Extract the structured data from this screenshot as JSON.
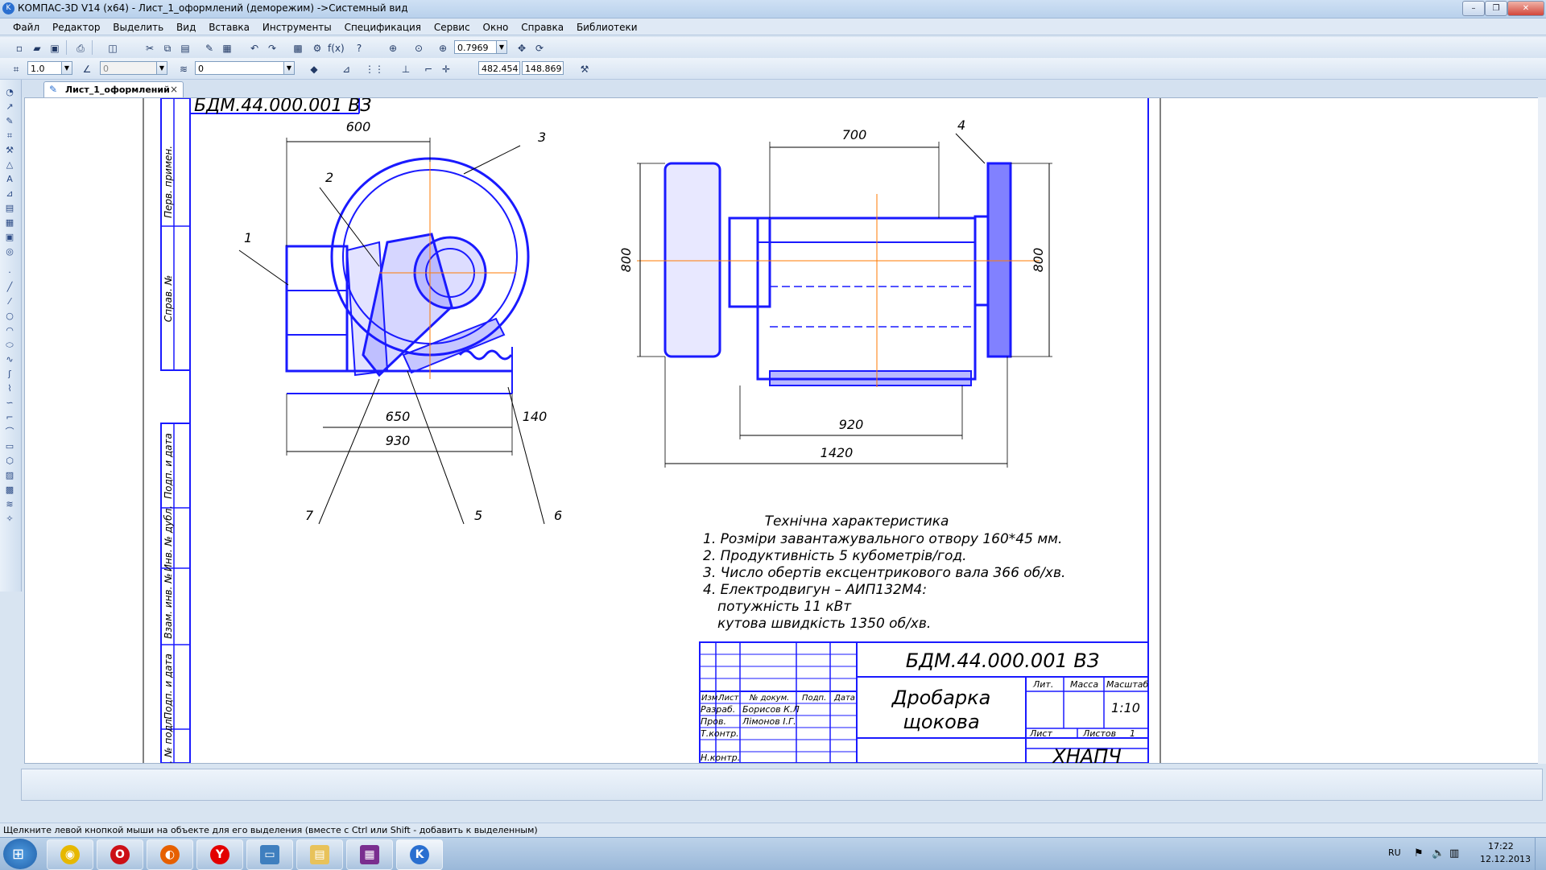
{
  "window": {
    "title": "КОМПАС-3D V14 (x64) - Лист_1_оформлений (деморежим) ->Системный вид",
    "app_icon": "kompas-logo-icon",
    "controls": [
      "minimize-icon",
      "maximize-icon",
      "close-icon"
    ]
  },
  "menu": {
    "items": [
      "Файл",
      "Редактор",
      "Выделить",
      "Вид",
      "Вставка",
      "Инструменты",
      "Спецификация",
      "Сервис",
      "Окно",
      "Справка",
      "Библиотеки"
    ]
  },
  "toolbar1": {
    "zoom_value": "0.7969"
  },
  "toolbar2": {
    "step_value": "1.0",
    "angle_value": "0",
    "layer_value": "0",
    "coord_x": "482.454",
    "coord_y": "148.869"
  },
  "tab": {
    "label": "Лист_1_оформлений",
    "close": "×"
  },
  "drawing": {
    "top_stamp": "БДМ.44.000.001 ВЗ",
    "side_labels": [
      "Перв. примен.",
      "Справ. №",
      "Подп. и дата",
      "Инв. № дубл.",
      "Взам. инв. №",
      "Подп. и дата",
      "Инв. № подл."
    ],
    "left_view": {
      "dims": [
        "600",
        "650",
        "930",
        "140"
      ],
      "leaders": [
        "1",
        "2",
        "3",
        "5",
        "6",
        "7"
      ]
    },
    "right_view": {
      "dims": [
        "700",
        "800",
        "800",
        "920",
        "1420"
      ],
      "leaders": [
        "4"
      ]
    },
    "tech_spec": {
      "title": "Технічна характеристика",
      "lines": [
        "1. Розміри завантажувального отвору 160*45 мм.",
        "2. Продуктивність 5 кубометрів/год.",
        "3. Число обертів ексцентрикового вала 366 об/хв.",
        "4. Електродвигун – АИП132М4:",
        "потужність 11 кВт",
        "кутова швидкість 1350 об/хв."
      ]
    },
    "title_block": {
      "designation": "БДМ.44.000.001 ВЗ",
      "name_line1": "Дробарка",
      "name_line2": "щокова",
      "col_headers": [
        "Изм.",
        "Лист",
        "№ докум.",
        "Подп.",
        "Дата"
      ],
      "rows": [
        {
          "role": "Разраб.",
          "person": "Борисов К.Л"
        },
        {
          "role": "Пров.",
          "person": "Лімонов І.Г."
        },
        {
          "role": "Т.контр.",
          "person": ""
        },
        {
          "role": "Н.контр.",
          "person": ""
        }
      ],
      "lit_label": "Лит.",
      "mass_label": "Масса",
      "scale_label": "Масштаб",
      "scale_value": "1:10",
      "sheet_label": "Лист",
      "sheets_label": "Листов",
      "sheets_value": "1",
      "org": "ХНАПЧ"
    }
  },
  "statusbar": {
    "hint": "Щелкните левой кнопкой мыши на объекте для его выделения (вместе с Ctrl или Shift - добавить к выделенным)"
  },
  "taskbar": {
    "apps": [
      "start-orb-icon",
      "chrome-icon",
      "opera-icon",
      "firefox-icon",
      "yandex-icon",
      "monitor-icon",
      "folder-icon",
      "winrar-icon",
      "kompas-icon"
    ],
    "lang": "RU",
    "time": "17:22",
    "date": "12.12.2013"
  }
}
